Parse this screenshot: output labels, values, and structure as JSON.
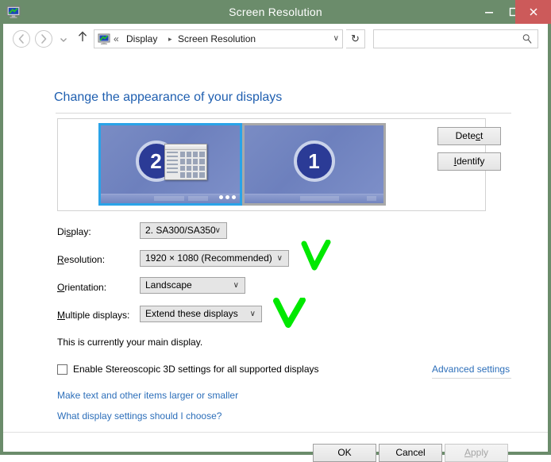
{
  "window": {
    "title": "Screen Resolution",
    "icon": "display-icon",
    "controls": {
      "minimize": "minimize-icon",
      "maximize": "maximize-icon",
      "close": "close-icon"
    },
    "titlebar_color": "#6b8c6b",
    "close_color": "#cc5a5a"
  },
  "navbar": {
    "back": "back-arrow-icon",
    "forward": "forward-arrow-icon",
    "recent": "chevron-down-icon",
    "up": "up-arrow-icon",
    "address": {
      "icon": "display-icon",
      "chevrons": "«",
      "segment1": "Display",
      "separator": "▸",
      "segment2": "Screen Resolution",
      "dropdown": "∨"
    },
    "refresh": "↻",
    "search": {
      "value": "",
      "placeholder": "",
      "icon": "search-icon"
    }
  },
  "page": {
    "heading": "Change the appearance of your displays",
    "heading_color": "#1f5fb0"
  },
  "preview": {
    "monitors": [
      {
        "number": "2",
        "selected": true,
        "has_window_icon": true,
        "has_taskbar_tray": true,
        "name": "monitor-preview-2"
      },
      {
        "number": "1",
        "selected": false,
        "has_window_icon": false,
        "has_taskbar_tray": false,
        "name": "monitor-preview-1"
      }
    ],
    "buttons": {
      "detect": {
        "pre": "Dete",
        "accel": "c",
        "post": "t"
      },
      "identify": {
        "pre": "",
        "accel": "I",
        "post": "dentify"
      }
    }
  },
  "settings": {
    "display": {
      "label_pre": "Di",
      "label_accel": "s",
      "label_post": "play:",
      "value": "2. SA300/SA350",
      "arrow": "∨"
    },
    "resolution": {
      "label_pre": "",
      "label_accel": "R",
      "label_post": "esolution:",
      "value": "1920 × 1080 (Recommended)",
      "arrow": "∨"
    },
    "orientation": {
      "label_pre": "",
      "label_accel": "O",
      "label_post": "rientation:",
      "value": "Landscape",
      "arrow": "∨"
    },
    "multiple_displays": {
      "label_pre": "",
      "label_accel": "M",
      "label_post": "ultiple displays:",
      "value": "Extend these displays",
      "arrow": "∨"
    },
    "main_display_note": "This is currently your main display."
  },
  "stereo": {
    "checked": false,
    "label": "Enable Stereoscopic 3D settings for all supported displays"
  },
  "links": {
    "advanced_settings": "Advanced settings",
    "make_text_larger": "Make text and other items larger or smaller",
    "what_settings": "What display settings should I choose?",
    "link_color": "#2d6fba"
  },
  "dialog_buttons": {
    "ok": "OK",
    "cancel": "Cancel",
    "apply": {
      "pre": "",
      "accel": "A",
      "post": "pply",
      "enabled": false
    }
  },
  "annotations": {
    "color": "#00e800",
    "marks": [
      {
        "name": "green-check-resolution",
        "target": "resolution-combobox"
      },
      {
        "name": "green-check-multiple-displays",
        "target": "multiple-displays-combobox"
      }
    ]
  }
}
